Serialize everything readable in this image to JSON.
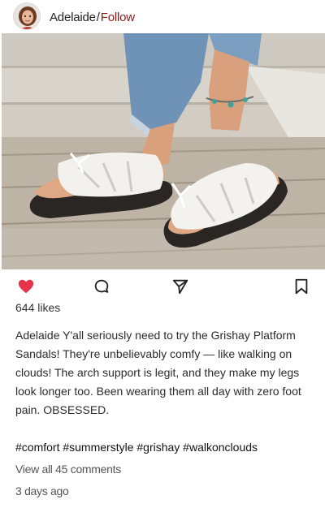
{
  "post": {
    "username": "Adelaide",
    "separator": "/",
    "follow_label": "Follow",
    "likes": "644 likes",
    "caption_user": "Adelaide",
    "caption_text": "Y'all seriously need to try the Grishay Platform Sandals! They're unbelievably comfy — like walking on clouds! The arch support is legit, and they make my legs look longer too. Been wearing them all day with zero foot pain. OBSESSED.",
    "hashtags": "#comfort #summerstyle #grishay #walkonclouds",
    "comments_link": "View all 45 comments",
    "timestamp": "3 days ago"
  },
  "icons": {
    "like": "heart-icon",
    "comment": "comment-bubble-icon",
    "share": "send-arrow-icon",
    "save": "bookmark-icon"
  },
  "colors": {
    "follow": "#8b1a1a",
    "liked_heart": "#e8334a",
    "icon_stroke": "#222222"
  }
}
